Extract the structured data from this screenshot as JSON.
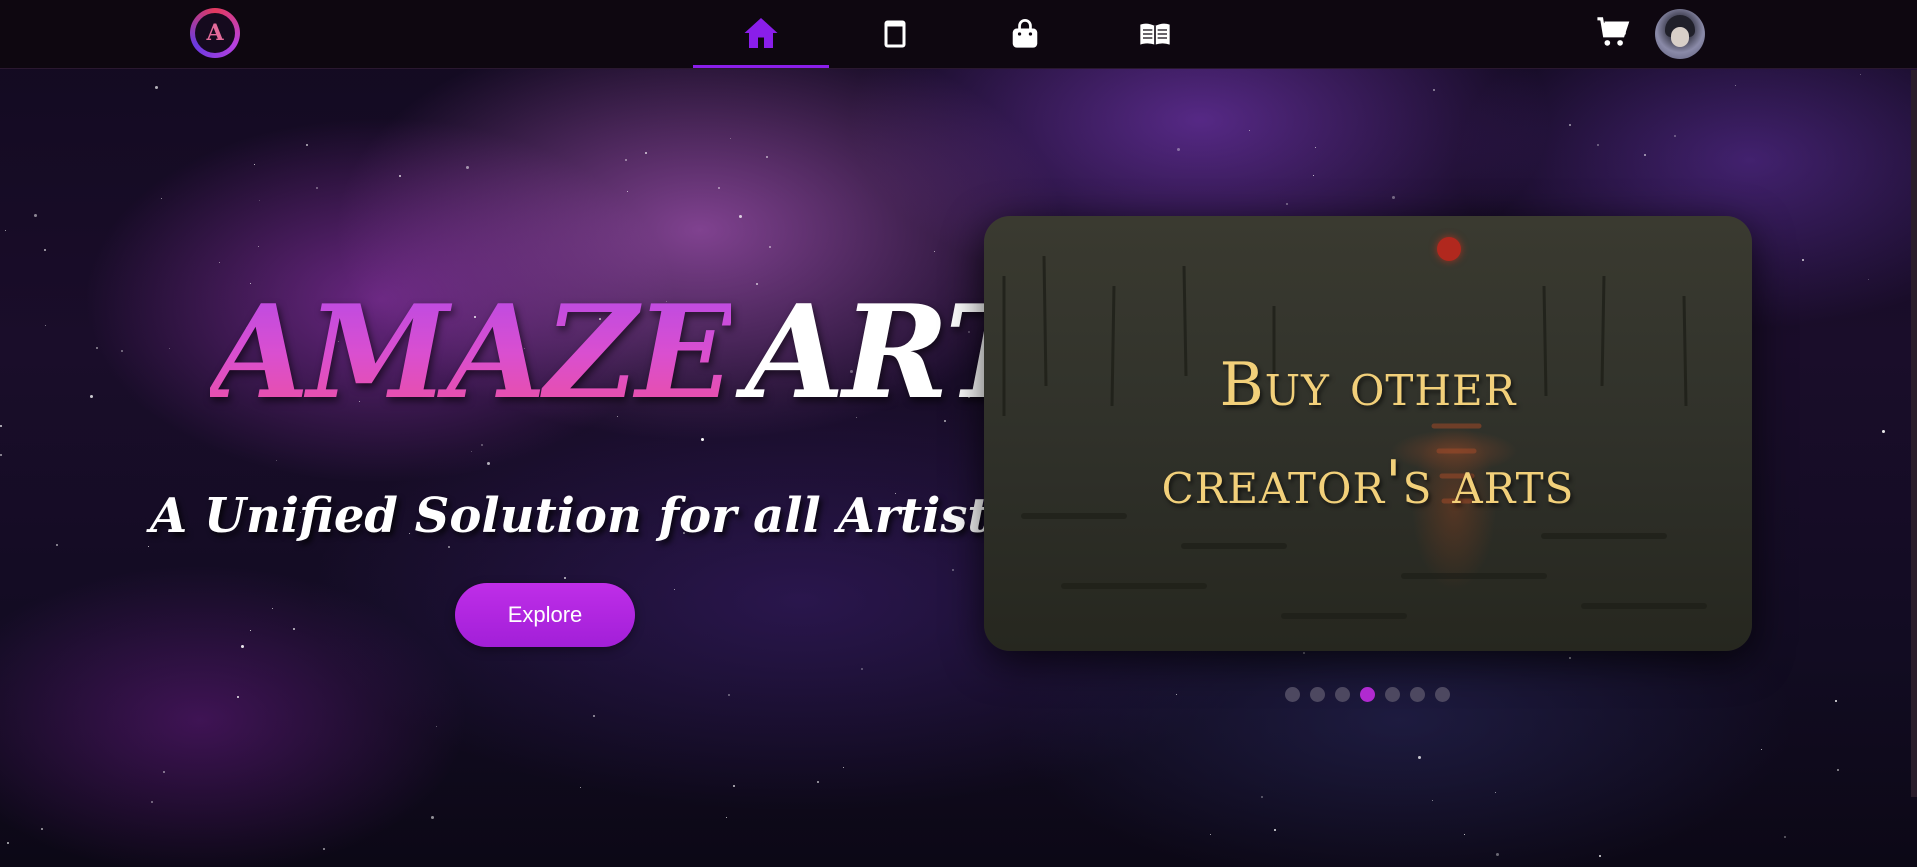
{
  "nav": {
    "logo_letter": "A",
    "items": [
      {
        "name": "home",
        "icon": "home-icon"
      },
      {
        "name": "gallery",
        "icon": "tablet-icon"
      },
      {
        "name": "shop",
        "icon": "shopping-bag-icon"
      },
      {
        "name": "blog",
        "icon": "open-book-icon"
      }
    ],
    "active_index": 0,
    "cart_icon": "cart-icon",
    "avatar_icon": "user-avatar"
  },
  "hero": {
    "title_part1": "AMAZE",
    "title_part2": "ART",
    "tagline": "A Unified Solution for all Artists !",
    "explore_label": "Explore"
  },
  "carousel": {
    "slide_line1": "Buy other",
    "slide_line2": "creator's arts",
    "dot_count": 7,
    "active_dot": 3
  },
  "colors": {
    "accent": "#8a1eea",
    "button": "#bf2ee8",
    "slide_text": "#f2d07a"
  }
}
